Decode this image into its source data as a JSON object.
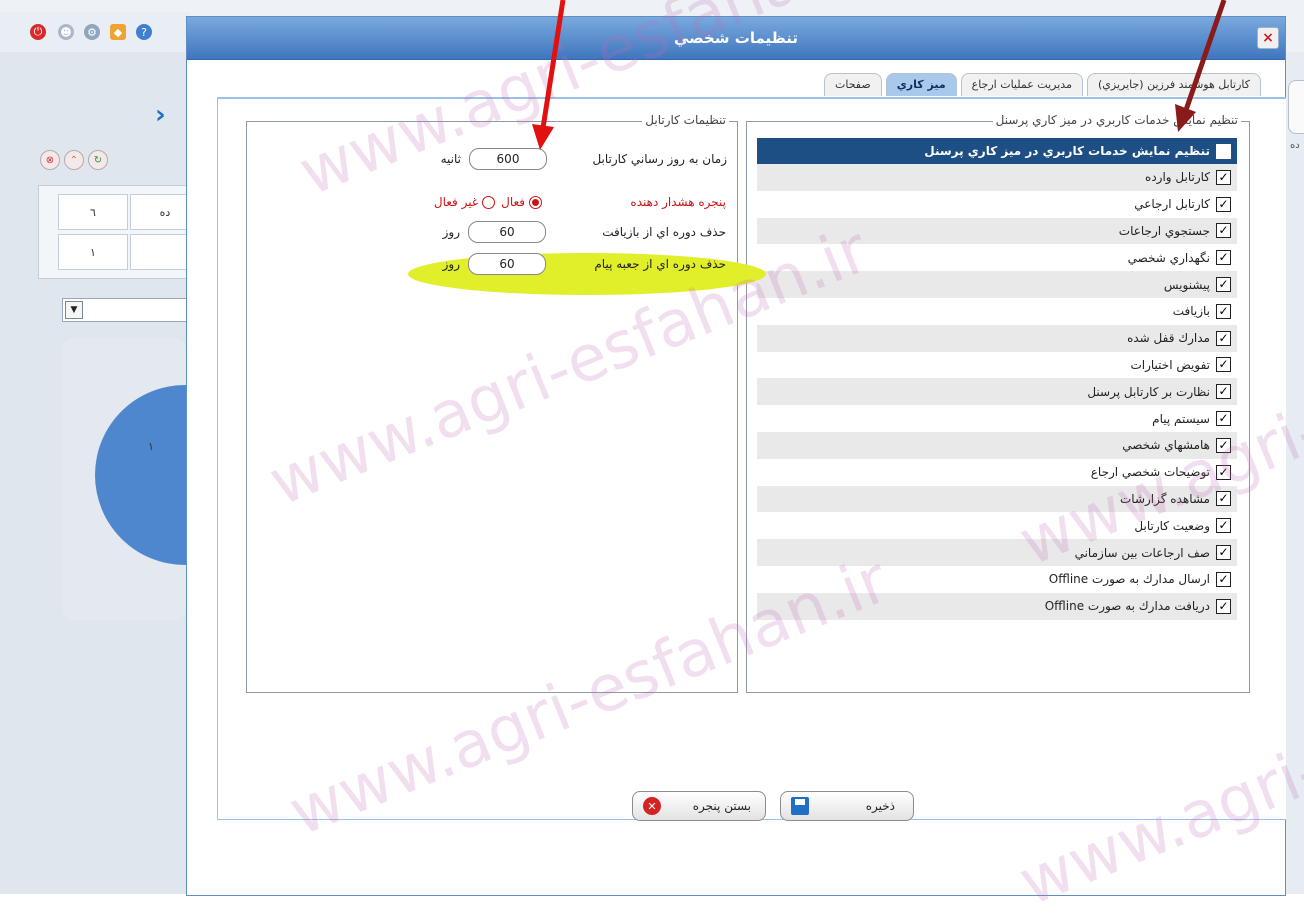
{
  "dialog": {
    "title": "تنظيمات شخصي",
    "close": "×"
  },
  "tabs": [
    {
      "label": "كارتابل هوشمند فرزين (جايريزي)"
    },
    {
      "label": "مديريت عمليات ارجاع"
    },
    {
      "label": "ميز كاري",
      "active": true
    },
    {
      "label": "صفحات"
    }
  ],
  "services": {
    "group_title": "تنظيم نمايش خدمات كاربري در ميز كاري پرسنل",
    "header_label": "تنظيم نمايش خدمات كاربري در ميز كاري پرسنل",
    "header_checked": false,
    "items": [
      {
        "label": "كارتابل وارده",
        "checked": true
      },
      {
        "label": "كارتابل ارجاعي",
        "checked": true
      },
      {
        "label": "جستجوي ارجاعات",
        "checked": true
      },
      {
        "label": "نگهداري شخصي",
        "checked": true
      },
      {
        "label": "پيشنويس",
        "checked": true
      },
      {
        "label": "بازيافت",
        "checked": true
      },
      {
        "label": "مدارك قفل شده",
        "checked": true
      },
      {
        "label": "تفويض اختيارات",
        "checked": true
      },
      {
        "label": "نظارت بر كارتابل پرسنل",
        "checked": true
      },
      {
        "label": "سيستم پيام",
        "checked": true
      },
      {
        "label": "هامشهاي شخصي",
        "checked": true
      },
      {
        "label": "توضيحات شخصي ارجاع",
        "checked": true
      },
      {
        "label": "مشاهده گزارشات",
        "checked": true
      },
      {
        "label": "وضعيت كارتابل",
        "checked": true
      },
      {
        "label": "صف ارجاعات بين سازماني",
        "checked": true
      },
      {
        "label": "ارسال مدارك به صورت Offline",
        "checked": true
      },
      {
        "label": "دريافت مدارك به صورت Offline",
        "checked": true
      }
    ]
  },
  "cartable": {
    "group_title": "تنظيمات كارتابل",
    "refresh_label": "زمان به روز رساني كارتابل",
    "refresh_value": "600",
    "refresh_unit": "ثانيه",
    "alert_label": "پنجره هشدار دهنده",
    "alert_on": "فعال",
    "alert_off": "غير فعال",
    "alert_selected": "on",
    "recycle_label": "حذف دوره اي از بازيافت",
    "recycle_value": "60",
    "recycle_unit": "روز",
    "inbox_label": "حذف دوره اي از جعبه پيام",
    "inbox_value": "60",
    "inbox_unit": "روز"
  },
  "buttons": {
    "save": "ذخيره",
    "close": "بستن پنجره"
  },
  "background": {
    "cells": [
      "٦",
      "ده",
      "١",
      ""
    ],
    "pie_label": "١",
    "right_text": "ده"
  },
  "watermark": "www.agri-esfahan.ir",
  "colors": {
    "title_bar": "#3f76bf",
    "header_row": "#1e4f84",
    "highlight": "#e0ef2a",
    "red_label": "#cc1111",
    "arrow_red": "#e31010",
    "arrow_dark": "#8b1a1a"
  }
}
